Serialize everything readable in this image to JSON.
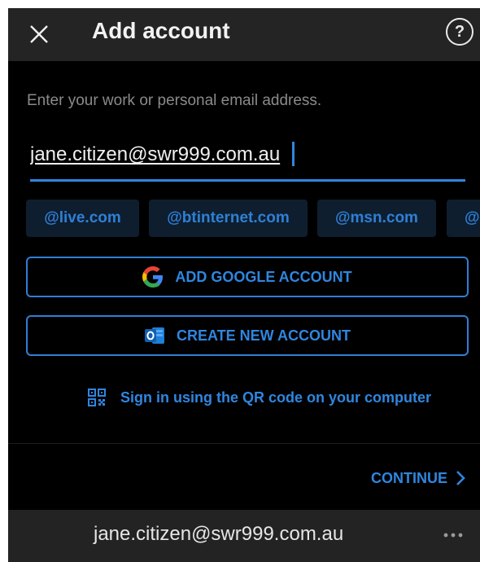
{
  "header": {
    "title": "Add account",
    "help_glyph": "?"
  },
  "form": {
    "prompt": "Enter your work or personal email address.",
    "email_value": "jane.citizen@swr999.com.au"
  },
  "domain_chips": [
    "@live.com",
    "@btinternet.com",
    "@msn.com",
    "@"
  ],
  "buttons": {
    "google_label": "ADD GOOGLE ACCOUNT",
    "create_label": "CREATE NEW ACCOUNT",
    "qr_label": "Sign in using the QR code on your computer",
    "continue_label": "CONTINUE"
  },
  "bottom": {
    "email": "jane.citizen@swr999.com.au"
  },
  "colors": {
    "accent": "#2f86e0",
    "background": "#000000",
    "bar": "#242424",
    "chip_bg": "#0e1e2e"
  },
  "icons": [
    "close-icon",
    "help-icon",
    "google-icon",
    "outlook-icon",
    "qr-code-icon",
    "chevron-right-icon",
    "more-icon"
  ]
}
